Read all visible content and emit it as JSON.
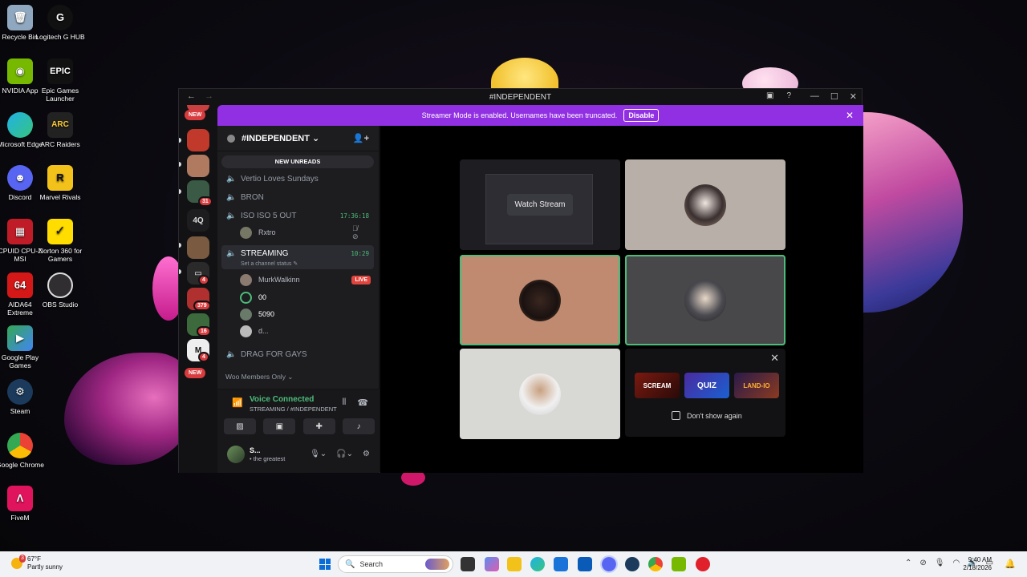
{
  "desktop_icons": [
    {
      "label": "Recycle Bin"
    },
    {
      "label": "Logitech G HUB"
    },
    {
      "label": "NVIDIA App"
    },
    {
      "label": "Epic Games Launcher",
      "icon_text": "EPIC"
    },
    {
      "label": "Microsoft Edge"
    },
    {
      "label": "ARC Raiders",
      "icon_text": "ARC"
    },
    {
      "label": "Discord"
    },
    {
      "label": "Marvel Rivals"
    },
    {
      "label": "CPUID CPU-Z MSI"
    },
    {
      "label": "Norton 360 for Gamers"
    },
    {
      "label": "AIDA64 Extreme",
      "icon_text": "64"
    },
    {
      "label": "OBS Studio"
    },
    {
      "label": "Google Play Games"
    },
    {
      "label": "Steam"
    },
    {
      "label": "Google Chrome"
    },
    {
      "label": "FiveM"
    }
  ],
  "window": {
    "title": "#INDEPENDENT",
    "back": "←",
    "forward": "→",
    "minimize": "—",
    "maximize": "☐",
    "close": "✕"
  },
  "rail": {
    "new_top": "NEW",
    "new_bottom": "NEW",
    "badges": [
      "31",
      "4",
      "379",
      "16",
      "4"
    ],
    "text_server": "4Q"
  },
  "banner": {
    "message": "Streamer Mode is enabled. Usernames have been truncated.",
    "button": "Disable",
    "close": "✕"
  },
  "sidebar": {
    "server_name": "#INDEPENDENT ⌄",
    "new_unreads": "NEW UNREADS",
    "channels": [
      {
        "name": "Vertio Loves Sundays"
      },
      {
        "name": "BRON"
      },
      {
        "name": "ISO ISO 5 OUT",
        "time": "17:36:18"
      },
      {
        "name": "STREAMING",
        "time": "10:29",
        "status": "Set a channel status ✎"
      },
      {
        "name": "DRAG FOR GAYS"
      }
    ],
    "iso_members": [
      {
        "name": "Rxtro"
      }
    ],
    "streaming_members": [
      {
        "name": "MurkWalkinn",
        "badge": "LIVE"
      },
      {
        "name": "00"
      },
      {
        "name": "5090"
      },
      {
        "name": "d..."
      }
    ],
    "members_only": "Woo Members Only ⌄"
  },
  "voice": {
    "status": "Voice Connected",
    "channel": "STREAMING / #INDEPENDENT"
  },
  "user": {
    "name": "S...",
    "status": "• the greatest"
  },
  "stage": {
    "watch_stream": "Watch Stream",
    "promo": {
      "games": [
        "SCREAM",
        "QUIZ",
        "LAND-IO"
      ],
      "dont_show": "Don't show again"
    }
  },
  "taskbar": {
    "temp": "67°F",
    "weather": "Partly sunny",
    "weather_badge": "3",
    "search": "Search",
    "time": "9:40 AM",
    "date": "2/18/2026"
  },
  "colors": {
    "accent": "#9130e3",
    "voice_green": "#4dbc7a",
    "live_red": "#e0443c"
  }
}
